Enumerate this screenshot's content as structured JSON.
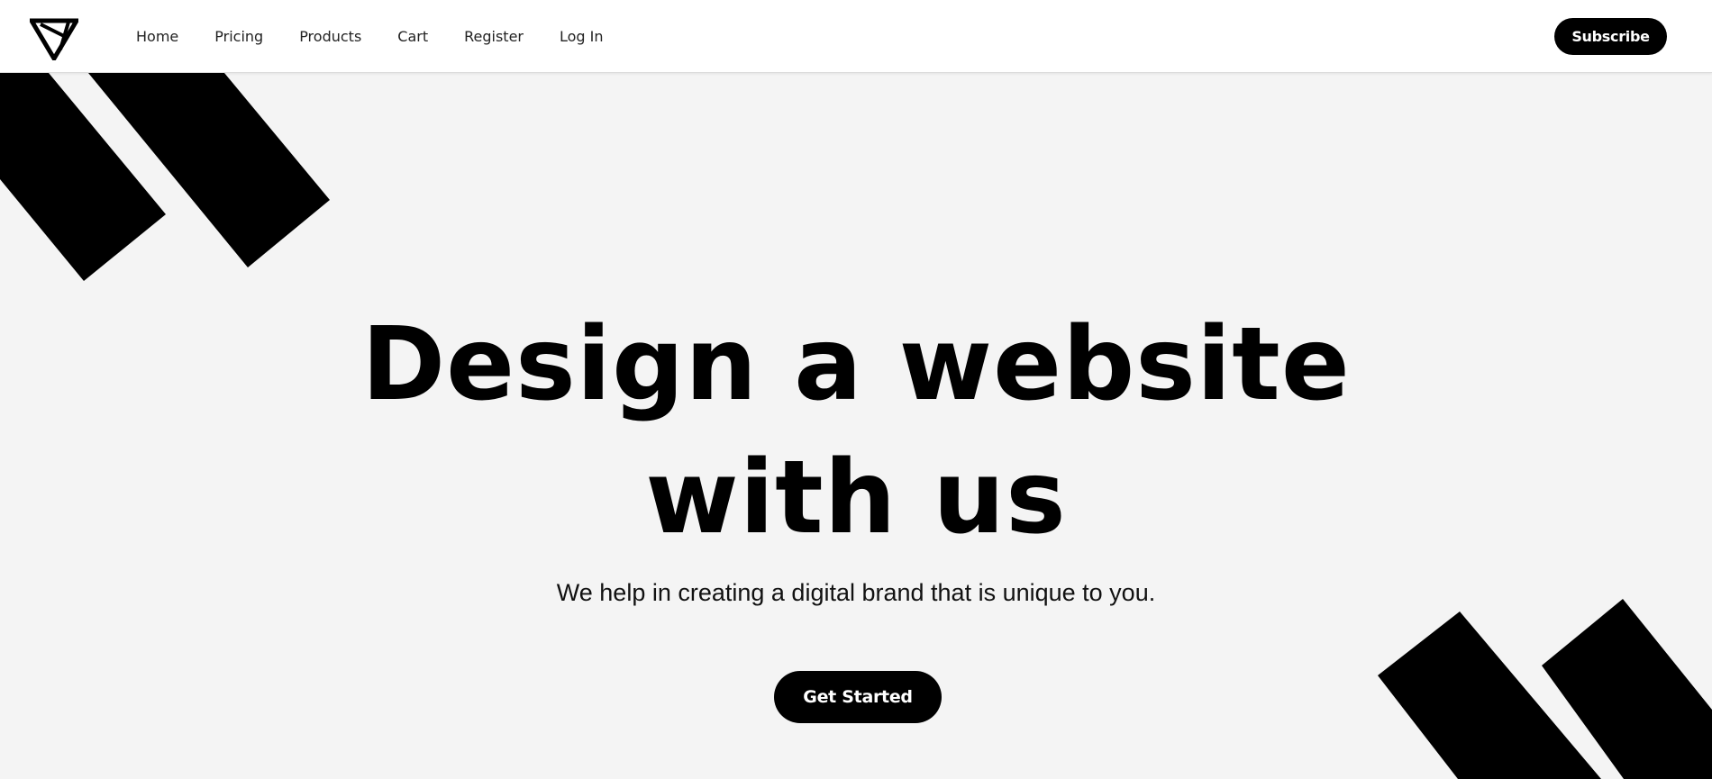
{
  "nav": {
    "items": [
      {
        "label": "Home"
      },
      {
        "label": "Pricing"
      },
      {
        "label": "Products"
      },
      {
        "label": "Cart"
      },
      {
        "label": "Register"
      },
      {
        "label": "Log In"
      }
    ],
    "subscribe_label": "Subscribe"
  },
  "hero": {
    "title_line1": "Design a website",
    "title_line2": "with us",
    "subtitle": "We help in creating a digital brand that is unique to you.",
    "cta_label": "Get Started"
  },
  "colors": {
    "background": "#f4f4f4",
    "header_background": "#ffffff",
    "accent": "#000000",
    "button_text": "#ffffff"
  },
  "icons": {
    "logo": "triangle-monogram-logo-icon"
  }
}
